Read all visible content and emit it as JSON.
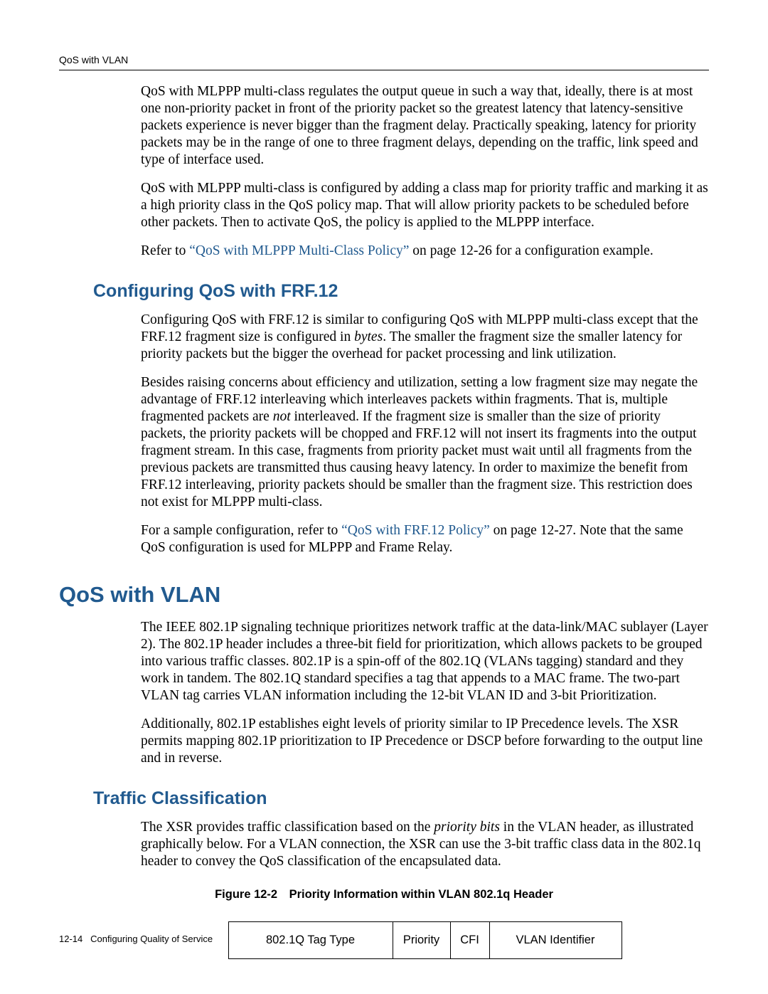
{
  "running_head": "QoS with VLAN",
  "intro": {
    "p1_a": "QoS with MLPPP multi-class regulates the output queue in such a way that, ideally, there is at most one non-priority packet in front of the priority packet so the greatest latency that latency-sensitive packets experience is never bigger than the fragment delay. Practically speaking, latency for priority packets may be in the range of one to three fragment delays, depending on the traffic, link speed and type of interface used.",
    "p2_a": "QoS with MLPPP multi-class is configured by adding a class map for priority traffic and marking it as a high priority class in the QoS policy map. That will allow priority packets to be scheduled before other packets. Then to activate QoS, the policy is applied to the MLPPP interface.",
    "p3_pre": "Refer to ",
    "p3_link": "“QoS with MLPPP Multi-Class Policy”",
    "p3_post": " on page 12-26 for a configuration example."
  },
  "frf": {
    "heading": "Configuring QoS with FRF.12",
    "p1_pre": "Configuring QoS with FRF.12 is similar to configuring QoS with MLPPP multi-class except that the FRF.12 fragment size is configured in ",
    "p1_em": "bytes",
    "p1_post": ". The smaller the fragment size the smaller latency for priority packets but the bigger the overhead for packet processing and link utilization.",
    "p2_pre": "Besides raising concerns about efficiency and utilization, setting a low fragment size may negate the advantage of FRF.12 interleaving which interleaves packets within fragments. That is, multiple fragmented packets are ",
    "p2_em": "not",
    "p2_post": " interleaved. If the fragment size is smaller than the size of priority packets, the priority packets will be chopped and FRF.12 will not insert its fragments into the output fragment stream. In this case, fragments from priority packet must wait until all fragments from the previous packets are transmitted thus causing heavy latency. In order to maximize the benefit from FRF.12 interleaving, priority packets should be smaller than the fragment size. This restriction does not exist for MLPPP multi-class.",
    "p3_pre": "For a sample configuration, refer to ",
    "p3_link": "“QoS with FRF.12 Policy”",
    "p3_post": " on page 12-27. Note that the same QoS configuration is used for MLPPP and Frame Relay."
  },
  "vlan": {
    "heading": "QoS with VLAN",
    "p1": "The IEEE 802.1P signaling technique prioritizes network traffic at the data-link/MAC sublayer (Layer 2). The 802.1P header includes a three-bit field for prioritization, which allows packets to be grouped into various traffic classes. 802.1P is a spin-off of the 802.1Q (VLANs tagging) standard and they work in tandem. The 802.1Q standard specifies a tag that appends to a MAC frame. The two-part VLAN tag carries VLAN information including the 12-bit VLAN ID and 3-bit Prioritization.",
    "p2": "Additionally, 802.1P establishes eight levels of priority similar to IP Precedence levels. The XSR permits mapping 802.1P prioritization to IP Precedence or DSCP before forwarding to the output line and in reverse."
  },
  "traffic": {
    "heading": "Traffic Classification",
    "p1_pre": "The XSR provides traffic classification based on the ",
    "p1_em": "priority bits",
    "p1_post": " in the VLAN header, as illustrated graphically below. For a VLAN connection, the XSR can use the 3-bit traffic class data in the 802.1q header to convey the QoS classification of the encapsulated data."
  },
  "figure": {
    "caption": "Figure 12-2 Priority Information within VLAN 802.1q Header",
    "cells": {
      "tag_type": "802.1Q Tag Type",
      "priority": "Priority",
      "cfi": "CFI",
      "vlan_id": "VLAN Identifier"
    }
  },
  "footer": {
    "page": "12-14",
    "title": "Configuring Quality of Service"
  }
}
